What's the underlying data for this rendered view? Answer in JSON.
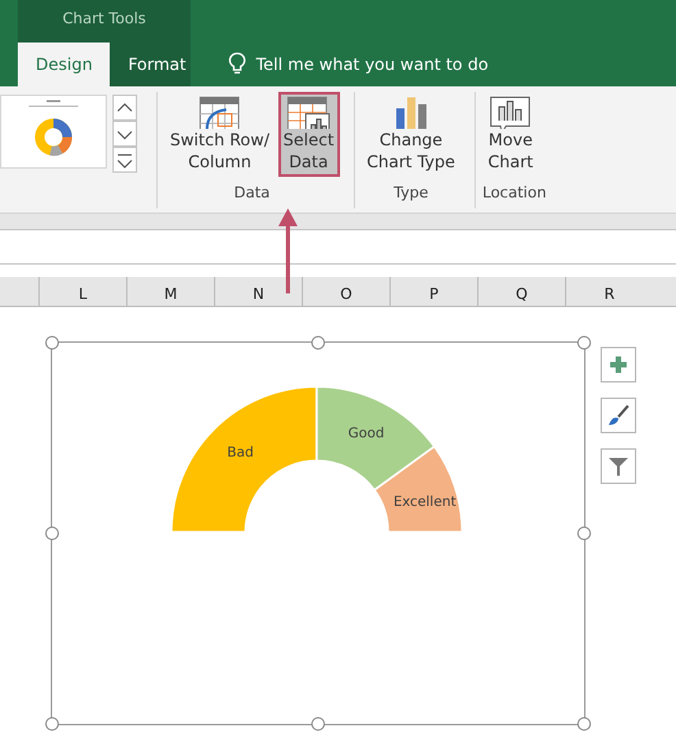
{
  "context_title": "Chart Tools",
  "tabs": [
    {
      "label": "Design",
      "selected": true
    },
    {
      "label": "Format",
      "selected": false
    }
  ],
  "tell_me": "Tell me what you want to do",
  "groups": [
    {
      "label": "Data",
      "buttons": [
        {
          "label": "Switch Row/\nColumn",
          "kind": "switch",
          "selected": false
        },
        {
          "label": "Select\nData",
          "kind": "select",
          "selected": true
        }
      ]
    },
    {
      "label": "Type",
      "buttons": [
        {
          "label": "Change\nChart Type",
          "kind": "change",
          "selected": false
        }
      ]
    },
    {
      "label": "Location",
      "buttons": [
        {
          "label": "Move\nChart",
          "kind": "move",
          "selected": false
        }
      ]
    }
  ],
  "columns": [
    "L",
    "M",
    "N",
    "O",
    "P",
    "Q",
    "R"
  ],
  "gauge": [
    {
      "label": "Bad",
      "color": "#ffc000"
    },
    {
      "label": "Good",
      "color": "#a9d18e"
    },
    {
      "label": "Excellent",
      "color": "#f4b183"
    }
  ]
}
